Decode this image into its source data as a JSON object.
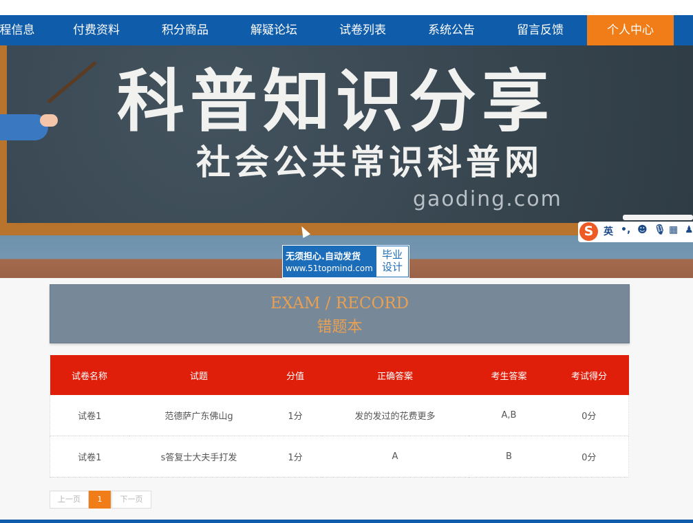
{
  "nav": {
    "items": [
      {
        "label": "程信息"
      },
      {
        "label": "付费资料"
      },
      {
        "label": "积分商品"
      },
      {
        "label": "解疑论坛"
      },
      {
        "label": "试卷列表"
      },
      {
        "label": "系统公告"
      },
      {
        "label": "留言反馈"
      },
      {
        "label": "个人中心"
      }
    ],
    "active_color": "#f07d18",
    "bar_color": "#0f5cab"
  },
  "banner": {
    "title": "科普知识分享",
    "subtitle": "社会公共常识科普网",
    "domain": "gaoding.com"
  },
  "ad": {
    "line1": "无须担心.自动发货",
    "url": "www.51topmind.com",
    "box_line1": "毕业",
    "box_line2": "设计"
  },
  "ime": {
    "logo": "S",
    "lang": "英",
    "punct": "•,",
    "icons": [
      "emoji-icon",
      "microphone-icon",
      "keyboard-icon",
      "user-icon"
    ]
  },
  "section": {
    "title_en": "EXAM / RECORD",
    "title_cn": "错题本"
  },
  "table": {
    "headers": [
      "试卷名称",
      "试题",
      "分值",
      "正确答案",
      "考生答案",
      "考试得分"
    ],
    "rows": [
      [
        "试卷1",
        "范德萨广东佛山g",
        "1分",
        "发的发过的花费更多",
        "A,B",
        "0分"
      ],
      [
        "试卷1",
        "s答复士大夫手打发",
        "1分",
        "A",
        "B",
        "0分"
      ]
    ],
    "header_color": "#e01f0b"
  },
  "pager": {
    "prev": "上一页",
    "current": "1",
    "next": "下一页"
  }
}
